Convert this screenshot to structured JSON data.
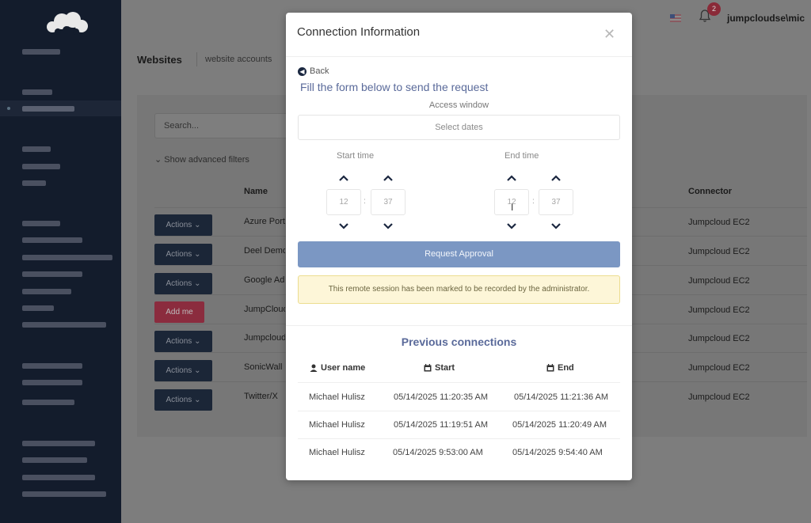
{
  "app": {
    "username": "jumpcloudse\\mic",
    "notification_count": "2",
    "page_title": "Websites",
    "page_subtitle": "website accounts"
  },
  "filters": {
    "search_placeholder": "Search...",
    "advanced_filters": "Show advanced filters"
  },
  "table": {
    "headers": {
      "name": "Name",
      "connector": "Connector"
    },
    "rows": [
      {
        "action": "Actions",
        "name": "Azure Portal",
        "connector": "Jumpcloud EC2"
      },
      {
        "action": "Actions",
        "name": "Deel Demo",
        "connector": "Jumpcloud EC2"
      },
      {
        "action": "Actions",
        "name": "Google Admin",
        "connector": "Jumpcloud EC2"
      },
      {
        "action": "Add me",
        "name": "JumpCloud",
        "connector": "Jumpcloud EC2"
      },
      {
        "action": "Actions",
        "name": "Jumpcloud",
        "connector": "Jumpcloud EC2"
      },
      {
        "action": "Actions",
        "name": "SonicWall",
        "connector": "Jumpcloud EC2"
      },
      {
        "action": "Actions",
        "name": "Twitter/X",
        "connector": "Jumpcloud EC2"
      }
    ]
  },
  "modal": {
    "title": "Connection Information",
    "back_label": "Back",
    "form_title": "Fill the form below to send the request",
    "access_window_label": "Access window",
    "select_dates_placeholder": "Select dates",
    "start_time_label": "Start time",
    "end_time_label": "End time",
    "start_hour": "12",
    "start_minute": "37",
    "end_hour": "12",
    "end_minute": "37",
    "request_button": "Request Approval",
    "alert_text": "This remote session has been marked to be recorded by the administrator.",
    "previous_title": "Previous connections",
    "previous_headers": {
      "user": "User name",
      "start": "Start",
      "end": "End"
    },
    "previous_rows": [
      {
        "user": "Michael Hulisz",
        "start": "05/14/2025 11:20:35 AM",
        "end": "05/14/2025 11:21:36 AM"
      },
      {
        "user": "Michael Hulisz",
        "start": "05/14/2025 11:19:51 AM",
        "end": "05/14/2025 11:20:49 AM"
      },
      {
        "user": "Michael Hulisz",
        "start": "05/14/2025 9:53:00 AM",
        "end": "05/14/2025 9:54:40 AM"
      }
    ]
  },
  "colors": {
    "sidebar": "#131c2c",
    "accent_text": "#5a6a9a",
    "request_button": "#7b97c3",
    "alert_bg": "#fdf6d8",
    "add_me_button": "#8b2c3e"
  }
}
